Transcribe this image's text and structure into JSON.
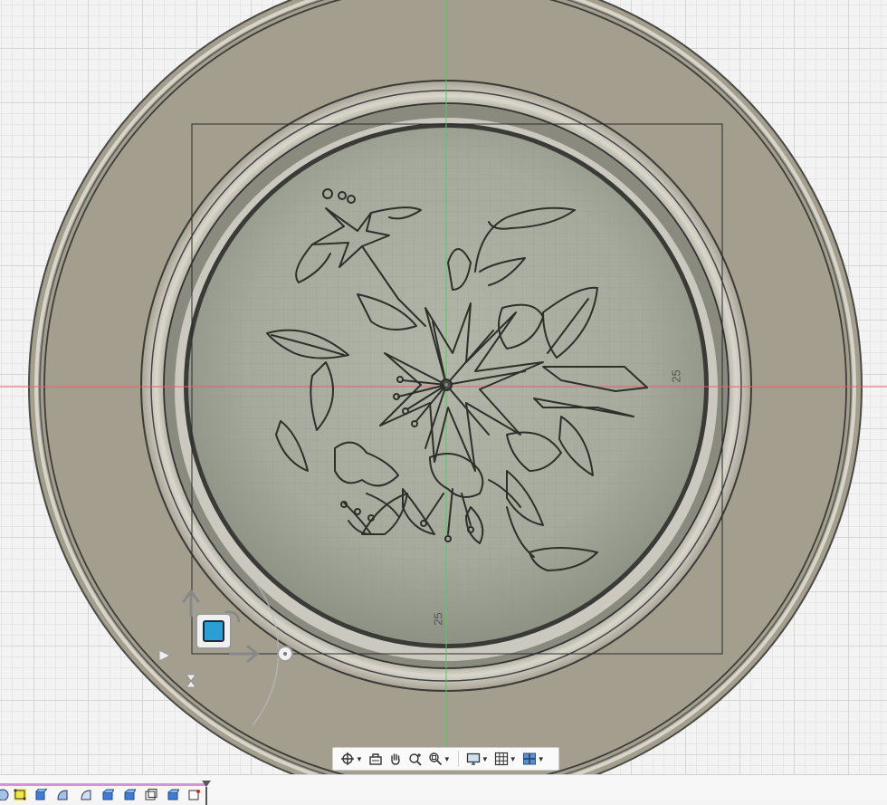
{
  "canvas": {
    "dimension_right": "25",
    "dimension_bottom": "25"
  },
  "view_cube": {
    "face_color": "#2a9fd6"
  },
  "nav_toolbar": {
    "items": [
      {
        "name": "orbit-icon",
        "has_menu": true
      },
      {
        "name": "look-at-icon",
        "has_menu": false
      },
      {
        "name": "pan-icon",
        "has_menu": false
      },
      {
        "name": "zoom-icon",
        "has_menu": false
      },
      {
        "name": "fit-icon",
        "has_menu": true
      },
      {
        "name": "display-settings-icon",
        "has_menu": true
      },
      {
        "name": "grid-icon",
        "has_menu": true
      },
      {
        "name": "viewports-icon",
        "has_menu": true
      }
    ]
  },
  "timeline": {
    "progress_color": "#d98fd9",
    "features": [
      "sketch-icon",
      "sketch-icon",
      "extrude-icon",
      "revolve-icon",
      "revolve-icon",
      "extrude-icon",
      "extrude-icon",
      "shell-icon",
      "extrude-icon",
      "decal-icon"
    ]
  },
  "colors": {
    "plate": "#a39e8e",
    "plate_inner": "#9da093",
    "origin_x_axis": "#d66",
    "origin_y_axis": "#5c5"
  }
}
